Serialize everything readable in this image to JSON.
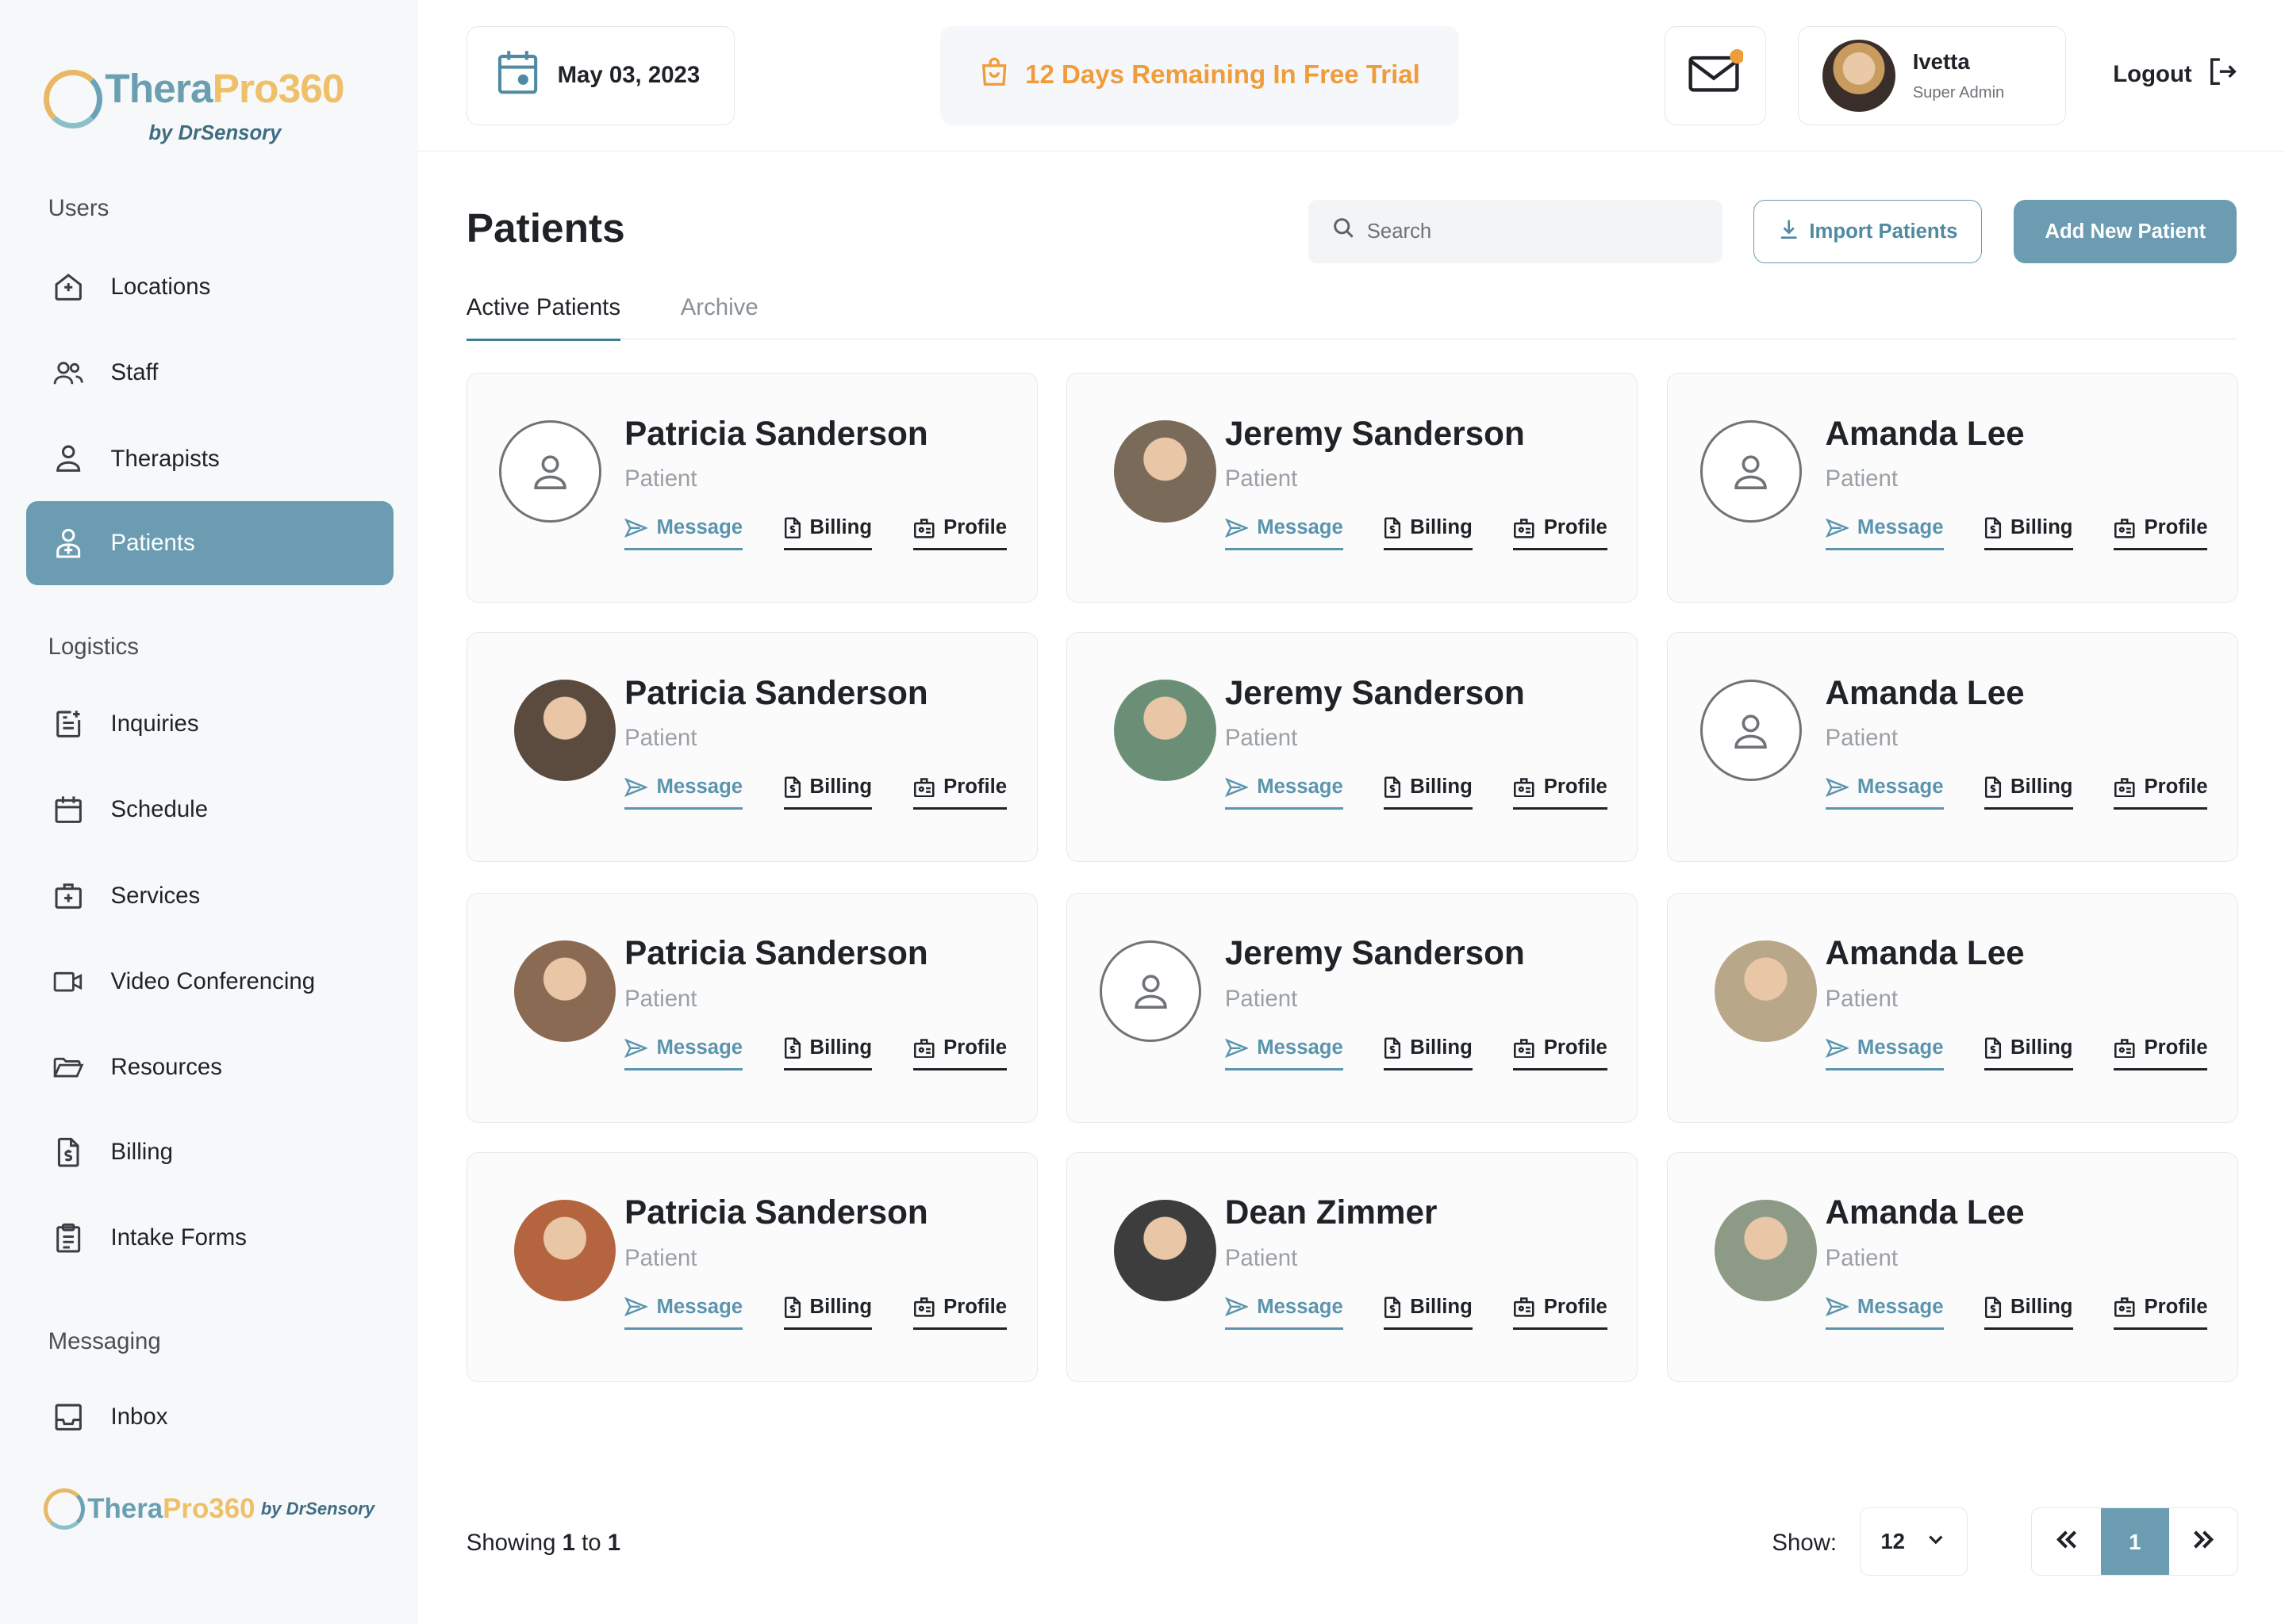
{
  "brand": {
    "logo_main_1": "Thera",
    "logo_main_2": "Pro360",
    "logo_by": "by DrSensory",
    "colors": {
      "accent": "#6b9cb1",
      "orange": "#ef9d3a",
      "gold": "#efc06a"
    }
  },
  "sidebar": {
    "sections": [
      {
        "label": "Users"
      },
      {
        "label": "Logistics"
      },
      {
        "label": "Messaging"
      }
    ],
    "items": [
      {
        "label": "Locations",
        "icon": "location-home-icon"
      },
      {
        "label": "Staff",
        "icon": "staff-icon"
      },
      {
        "label": "Therapists",
        "icon": "person-icon"
      },
      {
        "label": "Patients",
        "icon": "patient-icon",
        "active": true
      },
      {
        "label": "Inquiries",
        "icon": "inquiries-icon"
      },
      {
        "label": "Schedule",
        "icon": "calendar-icon"
      },
      {
        "label": "Services",
        "icon": "services-icon"
      },
      {
        "label": "Video Conferencing",
        "icon": "video-icon"
      },
      {
        "label": "Resources",
        "icon": "folder-icon"
      },
      {
        "label": "Billing",
        "icon": "billing-icon"
      },
      {
        "label": "Intake Forms",
        "icon": "clipboard-icon"
      },
      {
        "label": "Inbox",
        "icon": "inbox-icon"
      }
    ]
  },
  "header": {
    "date": "May 03, 2023",
    "trial": "12 Days Remaining In Free Trial",
    "user_name": "Ivetta",
    "user_role": "Super Admin",
    "logout": "Logout"
  },
  "main": {
    "title": "Patients",
    "search_placeholder": "Search",
    "import_label": "Import Patients",
    "add_label": "Add New Patient",
    "tabs": [
      {
        "label": "Active Patients"
      },
      {
        "label": "Archive"
      }
    ],
    "action_labels": {
      "message": "Message",
      "billing": "Billing",
      "profile": "Profile"
    },
    "patients": [
      {
        "name": "Patricia Sanderson",
        "role": "Patient",
        "photo": false
      },
      {
        "name": "Jeremy Sanderson",
        "role": "Patient",
        "photo": true,
        "tone": "#7a6a5a"
      },
      {
        "name": "Amanda Lee",
        "role": "Patient",
        "photo": false
      },
      {
        "name": "Patricia Sanderson",
        "role": "Patient",
        "photo": true,
        "tone": "#5b4a3e"
      },
      {
        "name": "Jeremy Sanderson",
        "role": "Patient",
        "photo": true,
        "tone": "#6b8f76"
      },
      {
        "name": "Amanda Lee",
        "role": "Patient",
        "photo": false
      },
      {
        "name": "Patricia Sanderson",
        "role": "Patient",
        "photo": true,
        "tone": "#8a6a52"
      },
      {
        "name": "Jeremy Sanderson",
        "role": "Patient",
        "photo": false
      },
      {
        "name": "Amanda Lee",
        "role": "Patient",
        "photo": true,
        "tone": "#b9a78a"
      },
      {
        "name": "Patricia Sanderson",
        "role": "Patient",
        "photo": true,
        "tone": "#b4643e"
      },
      {
        "name": "Dean Zimmer",
        "role": "Patient",
        "photo": true,
        "tone": "#3d3d3d"
      },
      {
        "name": "Amanda Lee",
        "role": "Patient",
        "photo": true,
        "tone": "#8c9a86"
      }
    ]
  },
  "footer": {
    "showing_prefix": "Showing",
    "showing_from": "1",
    "showing_to_word": "to",
    "showing_to": "1",
    "show_label": "Show:",
    "show_value": "12",
    "page_current": "1"
  }
}
